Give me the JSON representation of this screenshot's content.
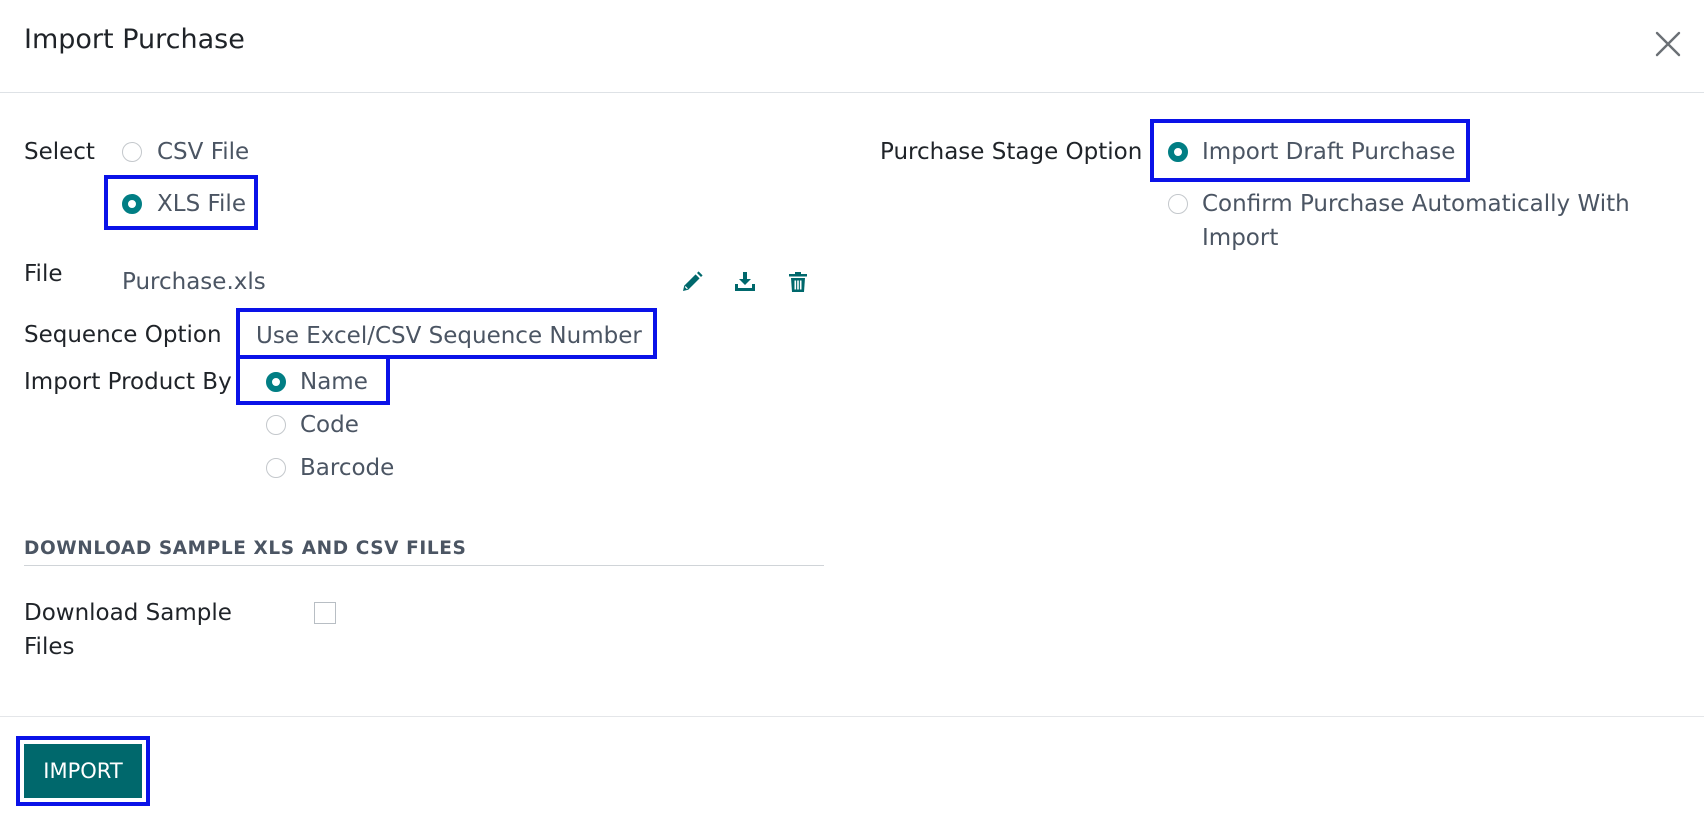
{
  "dialog": {
    "title": "Import Purchase",
    "close_icon": "close-icon"
  },
  "form": {
    "select_label": "Select",
    "file_type_options": [
      "CSV File",
      "XLS File"
    ],
    "file_type_selected": "XLS File",
    "file_label": "File",
    "file_value": "Purchase.xls",
    "file_actions": [
      "edit-icon",
      "download-icon",
      "trash-icon"
    ],
    "sequence_label": "Sequence Option",
    "sequence_value": "Use Excel/CSV Sequence Number",
    "product_label": "Import Product By",
    "product_options": [
      "Name",
      "Code",
      "Barcode"
    ],
    "product_selected": "Name",
    "stage_label": "Purchase Stage Option",
    "stage_options": [
      "Import Draft Purchase",
      "Confirm Purchase Automatically With Import"
    ],
    "stage_selected": "Import Draft Purchase"
  },
  "samples": {
    "section_title": "DOWNLOAD SAMPLE XLS AND CSV FILES",
    "download_label": "Download Sample Files",
    "download_checked": false
  },
  "footer": {
    "import_label": "IMPORT"
  },
  "colors": {
    "accent": "#017e84",
    "button": "#00686c",
    "highlight": "#0a12e8"
  }
}
